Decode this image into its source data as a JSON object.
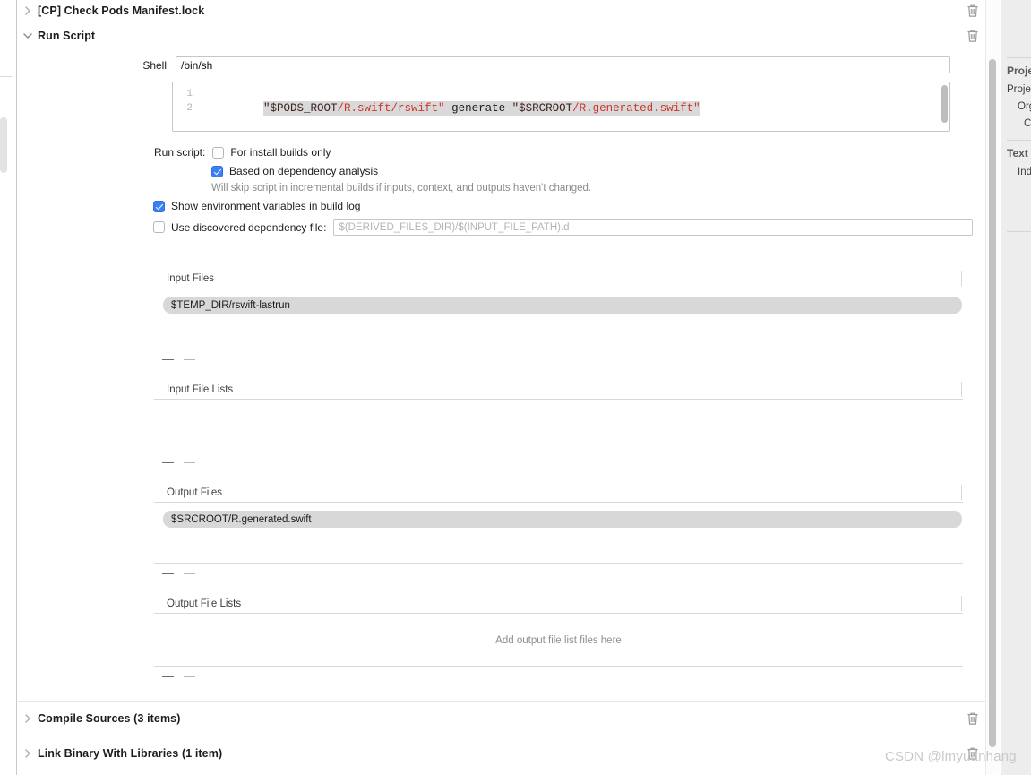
{
  "window": {
    "watermark": "CSDN @lmyuanhang"
  },
  "phases": [
    {
      "title": "[CP] Check Pods Manifest.lock",
      "expanded": false
    },
    {
      "title": "Run Script",
      "expanded": true
    },
    {
      "title": "Compile Sources (3 items)",
      "expanded": false
    },
    {
      "title": "Link Binary With Libraries (1 item)",
      "expanded": false
    }
  ],
  "run_script": {
    "shell_label": "Shell",
    "shell_value": "/bin/sh",
    "editor": {
      "line_numbers": [
        "1",
        "2"
      ],
      "code_line_1": {
        "segments": [
          {
            "text": "\"$PODS_ROOT",
            "kind": "var"
          },
          {
            "text": "/R.swift/rswift\"",
            "kind": "path"
          },
          {
            "text": " generate ",
            "kind": "plain"
          },
          {
            "text": "\"$SRCROOT",
            "kind": "var"
          },
          {
            "text": "/R.generated.swift\"",
            "kind": "path"
          }
        ],
        "plain": "\"$PODS_ROOT/R.swift/rswift\" generate \"$SRCROOT/R.generated.swift\""
      }
    },
    "run_script_label": "Run script:",
    "option_install_only": {
      "label": "For install builds only",
      "checked": false
    },
    "option_dependency_analysis": {
      "label": "Based on dependency analysis",
      "checked": true
    },
    "dependency_hint": "Will skip script in incremental builds if inputs, context, and outputs haven't changed.",
    "option_show_env": {
      "label": "Show environment variables in build log",
      "checked": true
    },
    "option_discovered_dep": {
      "label": "Use discovered dependency file:",
      "checked": false
    },
    "discovered_dep_placeholder": "$(DERIVED_FILES_DIR)/$(INPUT_FILE_PATH).d"
  },
  "file_tables": [
    {
      "header": "Input Files",
      "rows": [
        "$TEMP_DIR/rswift-lastrun"
      ],
      "empty_text": "",
      "body_height": 58
    },
    {
      "header": "Input File Lists",
      "rows": [],
      "empty_text": "",
      "body_height": 58
    },
    {
      "header": "Output Files",
      "rows": [
        "$SRCROOT/R.generated.swift"
      ],
      "empty_text": "",
      "body_height": 58
    },
    {
      "header": "Output File Lists",
      "rows": [],
      "empty_text": "Add output file list files here",
      "body_height": 58
    }
  ],
  "inspector": {
    "groups": [
      {
        "title": "Project Document",
        "fields": [
          "Project Format",
          "Organization",
          "Class Prefix"
        ]
      },
      {
        "title": "Text Settings",
        "fields": [
          "Indent Using"
        ]
      }
    ]
  },
  "colors": {
    "accent": "#3b7ff5",
    "code_path": "#d0342c",
    "code_var": "#3f2020",
    "chip_bg": "#d8d8d8",
    "panel_bg": "#ededed"
  }
}
